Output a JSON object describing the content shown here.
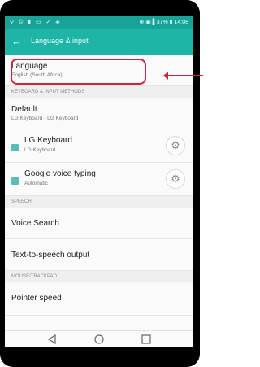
{
  "statusbar": {
    "left_icons": "⚲ © ▮ ▭ ✓ ◈",
    "right": "⊕ ▣ ▌37% ▮ 14:08"
  },
  "appbar": {
    "title": "Language & input"
  },
  "language": {
    "title": "Language",
    "value": "English (South Africa)"
  },
  "sections": {
    "keyboard": "KEYBOARD & INPUT METHODS",
    "speech": "SPEECH",
    "mouse": "MOUSE/TRACKPAD"
  },
  "default_kb": {
    "title": "Default",
    "value": "LG Keyboard - LG Keyboard"
  },
  "lg_keyboard": {
    "title": "LG Keyboard",
    "sub": "LG Keyboard",
    "checked": true
  },
  "google_voice": {
    "title": "Google voice typing",
    "sub": "Automatic",
    "checked": true
  },
  "voice_search": {
    "title": "Voice Search"
  },
  "tts": {
    "title": "Text-to-speech output"
  },
  "pointer_speed": {
    "title": "Pointer speed"
  },
  "icons": {
    "back": "back-arrow-icon",
    "gear": "gear-icon",
    "nav_back": "nav-back-icon",
    "nav_home": "nav-home-icon",
    "nav_recent": "nav-recent-icon"
  },
  "colors": {
    "status_bar": "#17a398",
    "app_bar": "#1fb5a6",
    "checkbox": "#5bbdb3",
    "highlight": "#d1233a"
  }
}
